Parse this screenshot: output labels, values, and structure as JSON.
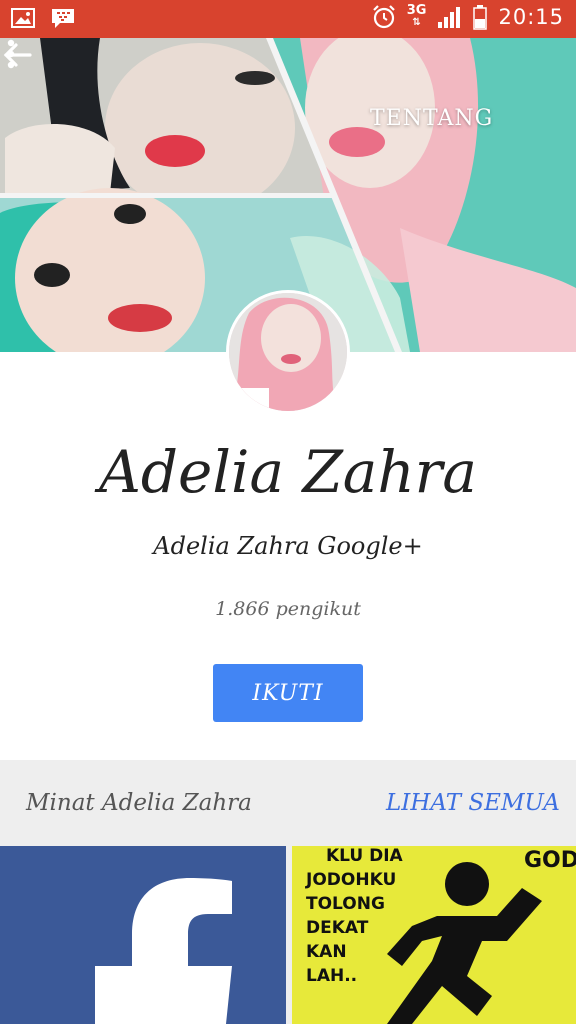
{
  "status_bar": {
    "time": "20:15",
    "network": "3G",
    "icons": [
      "gallery-icon",
      "bbm-icon",
      "alarm-icon",
      "signal-icon",
      "battery-icon"
    ]
  },
  "appbar": {
    "back_icon": "arrow-left-icon",
    "about_label": "TENTANG",
    "more_icon": "more-vert-icon"
  },
  "profile": {
    "name": "Adelia Zahra",
    "subtitle": "Adelia Zahra Google+",
    "followers": "1.866 pengikut",
    "follow_label": "IKUTI"
  },
  "interests": {
    "title": "Minat Adelia Zahra",
    "see_all": "LIHAT SEMUA",
    "tiles": [
      {
        "name": "facebook-tile",
        "icon": "facebook-icon"
      },
      {
        "name": "quote-tile",
        "lines": [
          "KLU DIA",
          "JODOHKU",
          "TOLONG",
          "DEKAT",
          "KAN",
          "LAH.."
        ],
        "corner": "GOD"
      }
    ]
  },
  "colors": {
    "status_bar": "#d8432e",
    "accent": "#4285f4",
    "link": "#3d6fe0",
    "facebook": "#3b5998",
    "quote_bg": "#e7e93a"
  }
}
